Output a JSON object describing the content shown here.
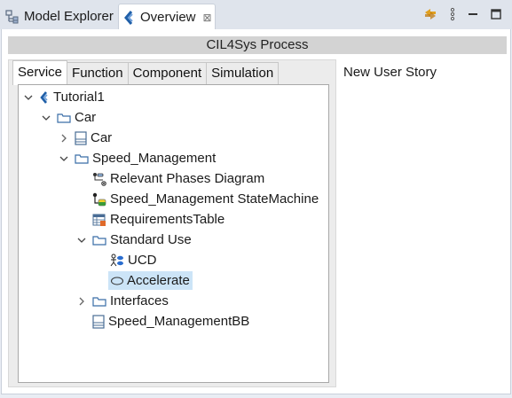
{
  "tabs": [
    {
      "label": "Model Explorer",
      "icon": "model-explorer-icon",
      "active": false
    },
    {
      "label": "Overview",
      "icon": "overview-icon",
      "active": true,
      "close": "⊠"
    }
  ],
  "toolbar": {
    "icons": [
      "sync-icon",
      "view-menu-icon",
      "minimize-icon",
      "maximize-icon"
    ]
  },
  "process_title": "CIL4Sys Process",
  "subtabs": [
    "Service",
    "Function",
    "Component",
    "Simulation"
  ],
  "selected_subtab": "Service",
  "tree": [
    {
      "label": "Tutorial1",
      "icon": "project-icon",
      "depth": 0,
      "expander": "expanded"
    },
    {
      "label": "Car",
      "icon": "folder-icon",
      "depth": 1,
      "expander": "expanded"
    },
    {
      "label": "Car",
      "icon": "block-icon",
      "depth": 2,
      "expander": "collapsed"
    },
    {
      "label": "Speed_Management",
      "icon": "folder-icon",
      "depth": 2,
      "expander": "expanded"
    },
    {
      "label": "Relevant Phases Diagram",
      "icon": "phases-diagram-icon",
      "depth": 3,
      "expander": "none"
    },
    {
      "label": "Speed_Management StateMachine",
      "icon": "state-machine-icon",
      "depth": 3,
      "expander": "none"
    },
    {
      "label": "RequirementsTable",
      "icon": "table-icon",
      "depth": 3,
      "expander": "none"
    },
    {
      "label": "Standard Use",
      "icon": "folder-icon",
      "depth": 3,
      "expander": "expanded"
    },
    {
      "label": "UCD",
      "icon": "use-case-diagram-icon",
      "depth": 4,
      "expander": "none"
    },
    {
      "label": "Accelerate",
      "icon": "use-case-icon",
      "depth": 4,
      "expander": "none",
      "selected": true
    },
    {
      "label": "Interfaces",
      "icon": "folder-icon",
      "depth": 3,
      "expander": "collapsed"
    },
    {
      "label": "Speed_ManagementBB",
      "icon": "block-icon",
      "depth": 3,
      "expander": "none"
    }
  ],
  "right_panel": {
    "label": "New User Story"
  },
  "colors": {
    "selection": "#cce4f7",
    "accent": "#1f5fa8",
    "header_bg": "#d3d3d3"
  }
}
